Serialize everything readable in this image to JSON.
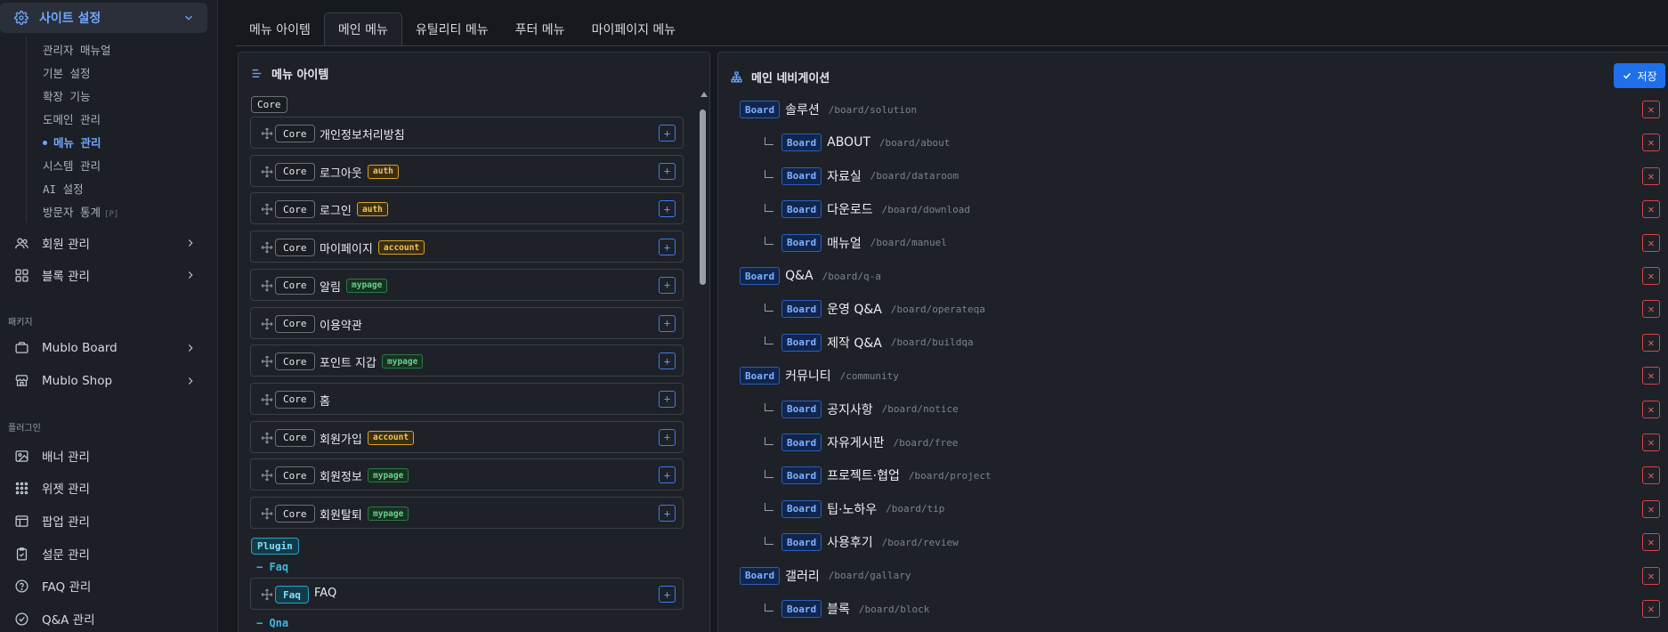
{
  "sidebar": {
    "active_section": "사이트 설정",
    "sub_items": [
      {
        "label": "관리자 매뉴얼"
      },
      {
        "label": "기본 설정"
      },
      {
        "label": "확장 기능"
      },
      {
        "label": "도메인 관리"
      },
      {
        "label": "메뉴 관리",
        "active": true
      },
      {
        "label": "시스템 관리"
      },
      {
        "label": "AI 설정"
      },
      {
        "label": "방문자 통계",
        "tag": "[P]"
      }
    ],
    "groups": [
      {
        "label": "회원 관리",
        "icon": "users-icon"
      },
      {
        "label": "블록 관리",
        "icon": "grid-icon"
      }
    ],
    "packages_title": "패키지",
    "packages": [
      {
        "label": "Mublo Board",
        "icon": "board-icon"
      },
      {
        "label": "Mublo Shop",
        "icon": "shop-icon"
      }
    ],
    "plugins_title": "플러그인",
    "plugins": [
      {
        "label": "배너 관리",
        "icon": "image-icon"
      },
      {
        "label": "위젯 관리",
        "icon": "dots-grid-icon"
      },
      {
        "label": "팝업 관리",
        "icon": "window-icon"
      },
      {
        "label": "설문 관리",
        "icon": "clipboard-icon"
      },
      {
        "label": "FAQ 관리",
        "icon": "help-circle-icon"
      },
      {
        "label": "Q&A 관리",
        "icon": "check-circle-icon"
      }
    ]
  },
  "tabs": [
    {
      "label": "메뉴 아이템"
    },
    {
      "label": "메인 메뉴",
      "active": true
    },
    {
      "label": "유틸리티 메뉴"
    },
    {
      "label": "푸터 메뉴"
    },
    {
      "label": "마이페이지 메뉴"
    }
  ],
  "left_panel": {
    "title": "메뉴 아이템",
    "core_group": "Core",
    "items": [
      {
        "source": "Core",
        "name": "개인정보처리방침",
        "tag": ""
      },
      {
        "source": "Core",
        "name": "로그아웃",
        "tag": "auth"
      },
      {
        "source": "Core",
        "name": "로그인",
        "tag": "auth"
      },
      {
        "source": "Core",
        "name": "마이페이지",
        "tag": "account"
      },
      {
        "source": "Core",
        "name": "알림",
        "tag": "mypage"
      },
      {
        "source": "Core",
        "name": "이용약관",
        "tag": ""
      },
      {
        "source": "Core",
        "name": "포인트 지갑",
        "tag": "mypage"
      },
      {
        "source": "Core",
        "name": "홈",
        "tag": ""
      },
      {
        "source": "Core",
        "name": "회원가입",
        "tag": "account"
      },
      {
        "source": "Core",
        "name": "회원정보",
        "tag": "mypage"
      },
      {
        "source": "Core",
        "name": "회원탈퇴",
        "tag": "mypage"
      }
    ],
    "plugin_group": "Plugin",
    "faq_group": "− Faq",
    "faq_item": {
      "source": "Faq",
      "name": "FAQ"
    },
    "qna_group": "− Qna",
    "add_symbol": "+"
  },
  "right_panel": {
    "title": "메인 네비게이션",
    "save_label": "저장",
    "badge": "Board",
    "del_symbol": "✕",
    "nav": [
      {
        "name": "솔루션",
        "path": "/board/solution",
        "level": 0
      },
      {
        "name": "ABOUT",
        "path": "/board/about",
        "level": 1
      },
      {
        "name": "자료실",
        "path": "/board/dataroom",
        "level": 1
      },
      {
        "name": "다운로드",
        "path": "/board/download",
        "level": 1
      },
      {
        "name": "매뉴얼",
        "path": "/board/manuel",
        "level": 1
      },
      {
        "name": "Q&A",
        "path": "/board/q-a",
        "level": 0
      },
      {
        "name": "운영 Q&A",
        "path": "/board/operateqa",
        "level": 1
      },
      {
        "name": "제작 Q&A",
        "path": "/board/buildqa",
        "level": 1
      },
      {
        "name": "커뮤니티",
        "path": "/community",
        "level": 0
      },
      {
        "name": "공지사항",
        "path": "/board/notice",
        "level": 1
      },
      {
        "name": "자유게시판",
        "path": "/board/free",
        "level": 1
      },
      {
        "name": "프로젝트·협업",
        "path": "/board/project",
        "level": 1
      },
      {
        "name": "팁·노하우",
        "path": "/board/tip",
        "level": 1
      },
      {
        "name": "사용후기",
        "path": "/board/review",
        "level": 1
      },
      {
        "name": "갤러리",
        "path": "/board/gallary",
        "level": 0
      },
      {
        "name": "블록",
        "path": "/board/block",
        "level": 1
      }
    ]
  }
}
